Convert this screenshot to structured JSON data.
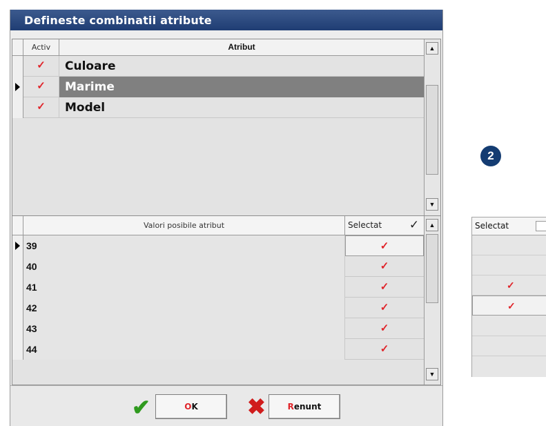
{
  "dialog": {
    "title": "Defineste combinatii atribute"
  },
  "attributes_grid": {
    "headers": {
      "activ": "Activ",
      "atribut": "Atribut"
    },
    "rows": [
      {
        "activ": "✓",
        "atribut": "Culoare",
        "selected": false
      },
      {
        "activ": "✓",
        "atribut": "Marime",
        "selected": true
      },
      {
        "activ": "✓",
        "atribut": "Model",
        "selected": false
      }
    ]
  },
  "values_grid": {
    "headers": {
      "values": "Valori posibile atribut",
      "selectat": "Selectat",
      "select_all_check": "✓"
    },
    "rows": [
      {
        "value": "39",
        "selectat": "✓",
        "current": true
      },
      {
        "value": "40",
        "selectat": "✓",
        "current": false
      },
      {
        "value": "41",
        "selectat": "✓",
        "current": false
      },
      {
        "value": "42",
        "selectat": "✓",
        "current": false
      },
      {
        "value": "43",
        "selectat": "✓",
        "current": false
      },
      {
        "value": "44",
        "selectat": "✓",
        "current": false
      }
    ]
  },
  "buttons": {
    "ok": {
      "first": "O",
      "rest": "K"
    },
    "cancel": {
      "first": "R",
      "rest": "enunt"
    }
  },
  "icons": {
    "ok_icon": "✔",
    "cancel_icon": "✖",
    "scroll_up": "▲",
    "scroll_down": "▼"
  },
  "step_badge": "2",
  "side_panel": {
    "header": "Selectat",
    "rows": [
      {
        "check": "",
        "current": false
      },
      {
        "check": "",
        "current": false
      },
      {
        "check": "✓",
        "current": false
      },
      {
        "check": "✓",
        "current": true
      },
      {
        "check": "",
        "current": false
      },
      {
        "check": "",
        "current": false
      }
    ]
  },
  "colors": {
    "titlebar": "#1f3d73",
    "check_red": "#e0242a",
    "ok_green": "#2f9a1e",
    "badge": "#143c72"
  }
}
